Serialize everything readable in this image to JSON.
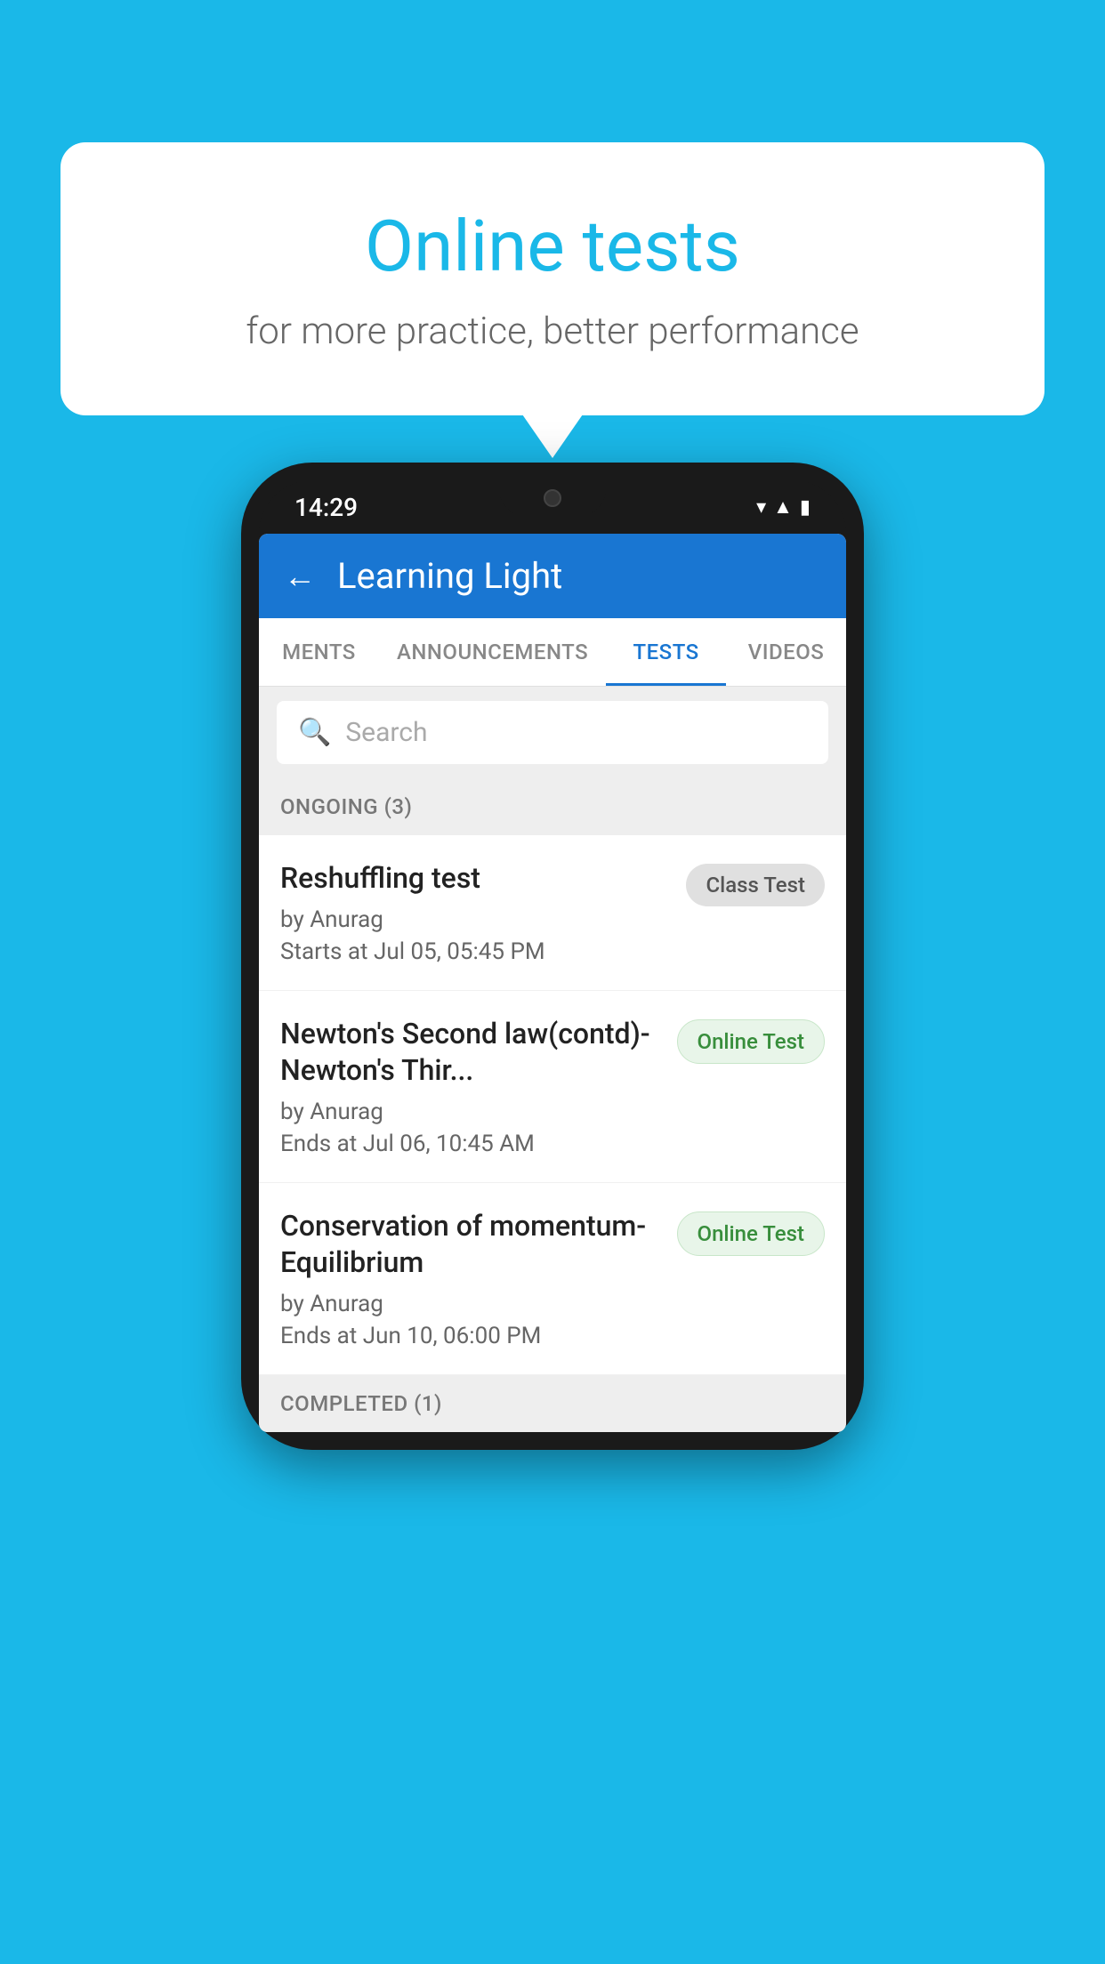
{
  "background_color": "#1ab8e8",
  "speech_bubble": {
    "title": "Online tests",
    "subtitle": "for more practice, better performance"
  },
  "phone": {
    "status_bar": {
      "time": "14:29"
    },
    "header": {
      "title": "Learning Light",
      "back_label": "←"
    },
    "tabs": [
      {
        "label": "MENTS",
        "active": false
      },
      {
        "label": "ANNOUNCEMENTS",
        "active": false
      },
      {
        "label": "TESTS",
        "active": true
      },
      {
        "label": "VIDEOS",
        "active": false
      }
    ],
    "search": {
      "placeholder": "Search"
    },
    "ongoing_section": {
      "label": "ONGOING (3)"
    },
    "tests": [
      {
        "name": "Reshuffling test",
        "author": "by Anurag",
        "time_label": "Starts at",
        "time": "Jul 05, 05:45 PM",
        "badge": "Class Test",
        "badge_type": "class"
      },
      {
        "name": "Newton's Second law(contd)-Newton's Thir...",
        "author": "by Anurag",
        "time_label": "Ends at",
        "time": "Jul 06, 10:45 AM",
        "badge": "Online Test",
        "badge_type": "online"
      },
      {
        "name": "Conservation of momentum-Equilibrium",
        "author": "by Anurag",
        "time_label": "Ends at",
        "time": "Jun 10, 06:00 PM",
        "badge": "Online Test",
        "badge_type": "online"
      }
    ],
    "completed_section": {
      "label": "COMPLETED (1)"
    }
  }
}
